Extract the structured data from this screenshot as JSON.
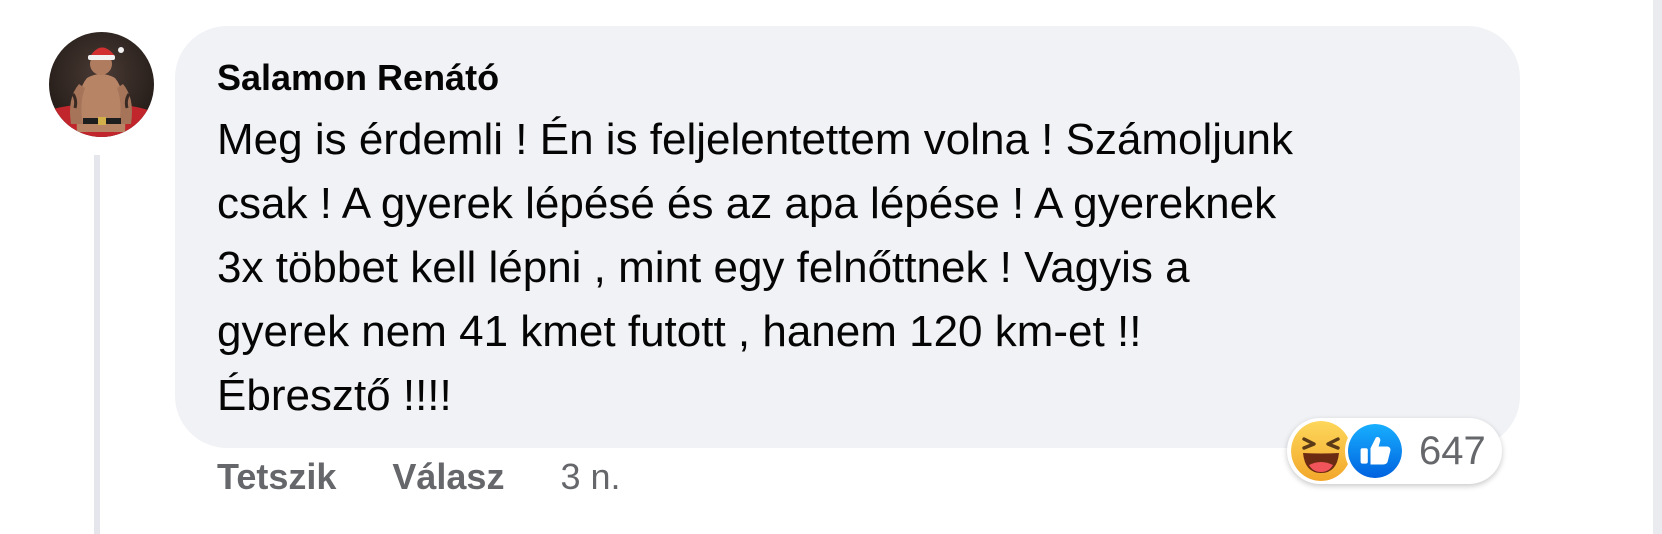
{
  "comment": {
    "author": "Salamon Renátó",
    "text": "Meg is érdemli ! Én is feljelentettem volna ! Számoljunk\ncsak ! A gyerek lépésé és az apa lépése ! A gyereknek\n3x többet kell lépni , mint egy felnőttnek ! Vagyis a\ngyerek nem 41 kmet futott , hanem 120 km-et !!\nÉbresztő !!!!",
    "avatar_icon": "profile-photo"
  },
  "actions": {
    "like_label": "Tetszik",
    "reply_label": "Válasz",
    "timestamp": "3 n."
  },
  "reactions": {
    "icons": [
      "haha-reaction-icon",
      "like-reaction-icon"
    ],
    "count": "647"
  },
  "colors": {
    "bubble_bg": "#f0f2f5",
    "text": "#050505",
    "secondary_text": "#65676b",
    "like_blue": "#1877f2",
    "haha_yellow": "#f7b928"
  }
}
